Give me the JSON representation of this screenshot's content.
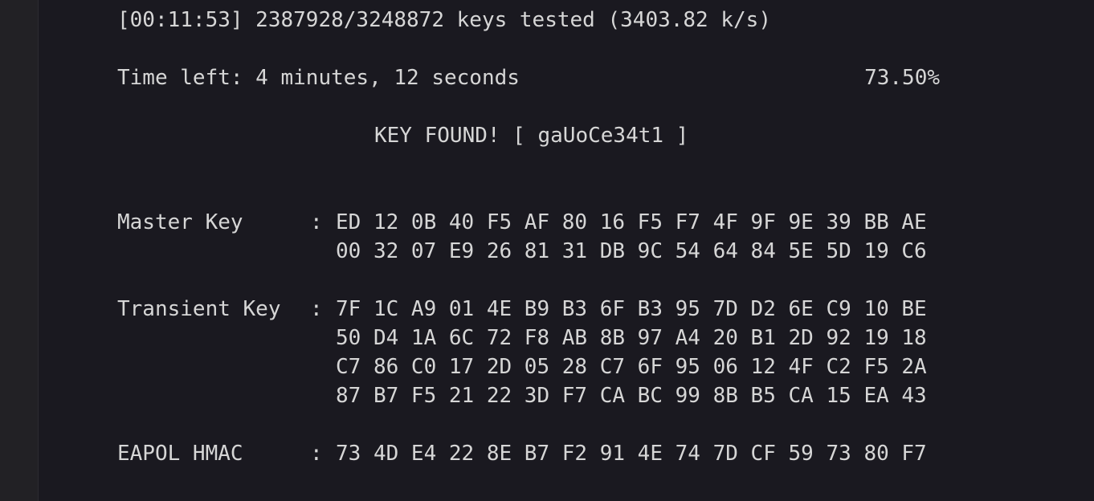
{
  "progress": {
    "line": "[00:11:53] 2387928/3248872 keys tested (3403.82 k/s)",
    "time_left": "Time left: 4 minutes, 12 seconds",
    "percent": "73.50%",
    "percent_value": 73.5
  },
  "result": {
    "key_found": "KEY FOUND! [ gaUoCe34t1 ]"
  },
  "keys": {
    "master": {
      "label": "Master Key",
      "colon": ":",
      "rows": [
        "ED 12 0B 40 F5 AF 80 16 F5 F7 4F 9F 9E 39 BB AE",
        "00 32 07 E9 26 81 31 DB 9C 54 64 84 5E 5D 19 C6"
      ]
    },
    "transient": {
      "label": "Transient Key",
      "colon": ":",
      "rows": [
        "7F 1C A9 01 4E B9 B3 6F B3 95 7D D2 6E C9 10 BE",
        "50 D4 1A 6C 72 F8 AB 8B 97 A4 20 B1 2D 92 19 18",
        "C7 86 C0 17 2D 05 28 C7 6F 95 06 12 4F C2 F5 2A",
        "87 B7 F5 21 22 3D F7 CA BC 99 8B B5 CA 15 EA 43"
      ]
    },
    "eapol": {
      "label": "EAPOL HMAC",
      "colon": ":",
      "rows": [
        "73 4D E4 22 8E B7 F2 91 4E 74 7D CF 59 73 80 F7"
      ]
    }
  },
  "colors": {
    "background": "#1a1920",
    "text": "#d6d6d6",
    "sidebar": "#222125"
  }
}
